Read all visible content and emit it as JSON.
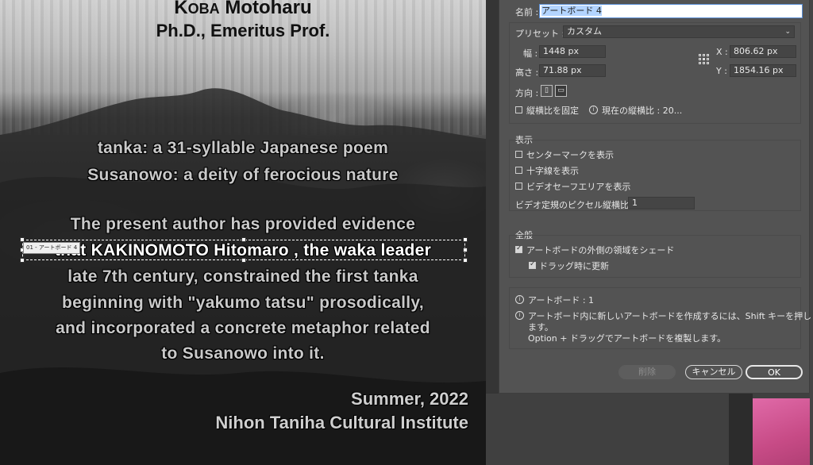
{
  "artwork": {
    "author_prefix": "K",
    "author_smallcaps": "OBA",
    "author_rest": " Motoharu",
    "author_title": "Ph.D., Emeritus Prof.",
    "definitions": [
      "tanka: a 31-syllable Japanese poem",
      "Susanowo: a deity of ferocious nature"
    ],
    "body": [
      "The present author has provided evidence",
      "that KAKINOMOTO Hitomaro , the waka leader",
      "late 7th century, constrained  the first tanka",
      "beginning with \"yakumo tatsu\" prosodically,",
      "and incorporated a concrete metaphor related",
      "to Susanowo into it."
    ],
    "date": "Summer, 2022",
    "institute": "Nihon Taniha Cultural Institute"
  },
  "selection": {
    "artboard_tag": "01 - アートボード 4"
  },
  "dialog": {
    "name_label": "名前 :",
    "name_value": "アートボード 4",
    "preset_label": "プリセット :",
    "preset_value": "カスタム",
    "width_label": "幅 :",
    "width_value": "1448 px",
    "height_label": "高さ :",
    "height_value": "71.88 px",
    "x_label": "X :",
    "x_value": "806.62 px",
    "y_label": "Y :",
    "y_value": "1854.16 px",
    "orientation_label": "方向 :",
    "lock_ratio_label": "縦横比を固定",
    "current_ratio_label": "現在の縦横比 : 20...",
    "display_section": "表示",
    "show_center_mark": "センターマークを表示",
    "show_crosshairs": "十字線を表示",
    "show_video_safe": "ビデオセーフエリアを表示",
    "video_ratio_label": "ビデオ定規のピクセル縦横比 :",
    "video_ratio_value": "1",
    "general_section": "全般",
    "shade_outside": "アートボードの外側の領域をシェード",
    "update_while_drag": "ドラッグ時に更新",
    "artboard_count": "アートボード : 1",
    "tip_line1": "アートボード内に新しいアートボードを作成するには、Shift キーを押し",
    "tip_line2": "ます。",
    "tip_line3": "Option + ドラッグでアートボードを複製します。",
    "delete_button": "削除",
    "cancel_button": "キャンセル",
    "ok_button": "OK"
  },
  "checkbox_states": {
    "lock_ratio": false,
    "show_center_mark": false,
    "show_crosshairs": false,
    "show_video_safe": false,
    "shade_outside": true,
    "update_while_drag": true
  }
}
